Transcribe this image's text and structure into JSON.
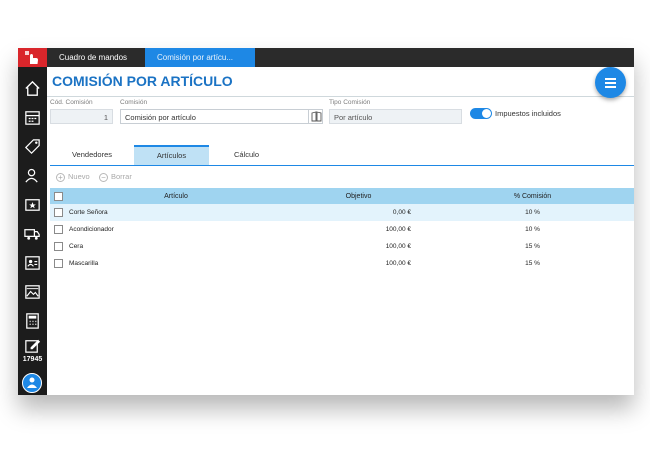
{
  "topbar": {
    "tabs": [
      "Cuadro de mandos",
      "Comisión por artícu..."
    ]
  },
  "page": {
    "title": "COMISIÓN POR ARTÍCULO"
  },
  "form": {
    "code_label": "Cód. Comisión",
    "code_value": "1",
    "name_label": "Comisión",
    "name_value": "Comisión por artículo",
    "type_label": "Tipo Comisión",
    "type_value": "Por artículo",
    "taxes_label": "Impuestos incluidos",
    "taxes_on": true
  },
  "tabs": [
    "Vendedores",
    "Artículos",
    "Cálculo"
  ],
  "actions": {
    "new": "Nuevo",
    "delete": "Borrar"
  },
  "table": {
    "headers": [
      "Artículo",
      "Objetivo",
      "% Comisión"
    ],
    "rows": [
      [
        "Corte Señora",
        "0,00 €",
        "10 %"
      ],
      [
        "Acondicionador",
        "100,00 €",
        "10 %"
      ],
      [
        "Cera",
        "100,00 €",
        "15 %"
      ],
      [
        "Mascarilla",
        "100,00 €",
        "15 %"
      ]
    ]
  },
  "sidebar": {
    "icons": [
      "home-icon",
      "calendar-icon",
      "tag-icon",
      "users-icon",
      "star-card-icon",
      "truck-icon",
      "id-card-icon",
      "image-icon",
      "calculator-icon",
      "edit-icon"
    ],
    "badge_count": "17945"
  },
  "colors": {
    "accent": "#1e88e5",
    "title": "#1b73c4",
    "brand": "#d9262b",
    "header_row": "#9fd4f0"
  }
}
